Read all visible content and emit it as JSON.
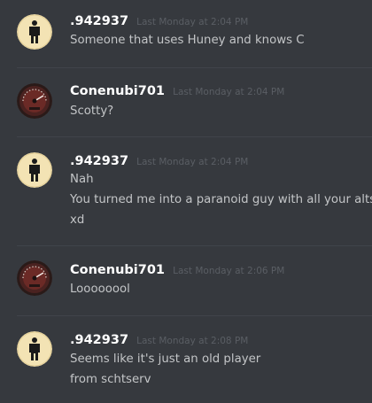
{
  "messages": [
    {
      "author": ".942937",
      "timestamp": "Last Monday at 2:04 PM",
      "avatar": "stick-figure-avatar",
      "lines": [
        "Someone that uses Huney and knows C"
      ]
    },
    {
      "author": "Conenubi701",
      "timestamp": "Last Monday at 2:04 PM",
      "avatar": "speedometer-avatar",
      "lines": [
        "Scotty?"
      ]
    },
    {
      "author": ".942937",
      "timestamp": "Last Monday at 2:04 PM",
      "avatar": "stick-figure-avatar",
      "lines": [
        "Nah",
        "You turned me into a paranoid guy with all your alts",
        "xd"
      ]
    },
    {
      "author": "Conenubi701",
      "timestamp": "Last Monday at 2:06 PM",
      "avatar": "speedometer-avatar",
      "lines": [
        "Loooooool"
      ]
    },
    {
      "author": ".942937",
      "timestamp": "Last Monday at 2:08 PM",
      "avatar": "stick-figure-avatar",
      "lines": [
        "Seems like it's just an old player",
        "from schtserv"
      ]
    }
  ],
  "colors": {
    "background": "#36393e",
    "username": "#ffffff",
    "timestamp": "#5a5e64",
    "message_text": "#c3c5c7"
  }
}
